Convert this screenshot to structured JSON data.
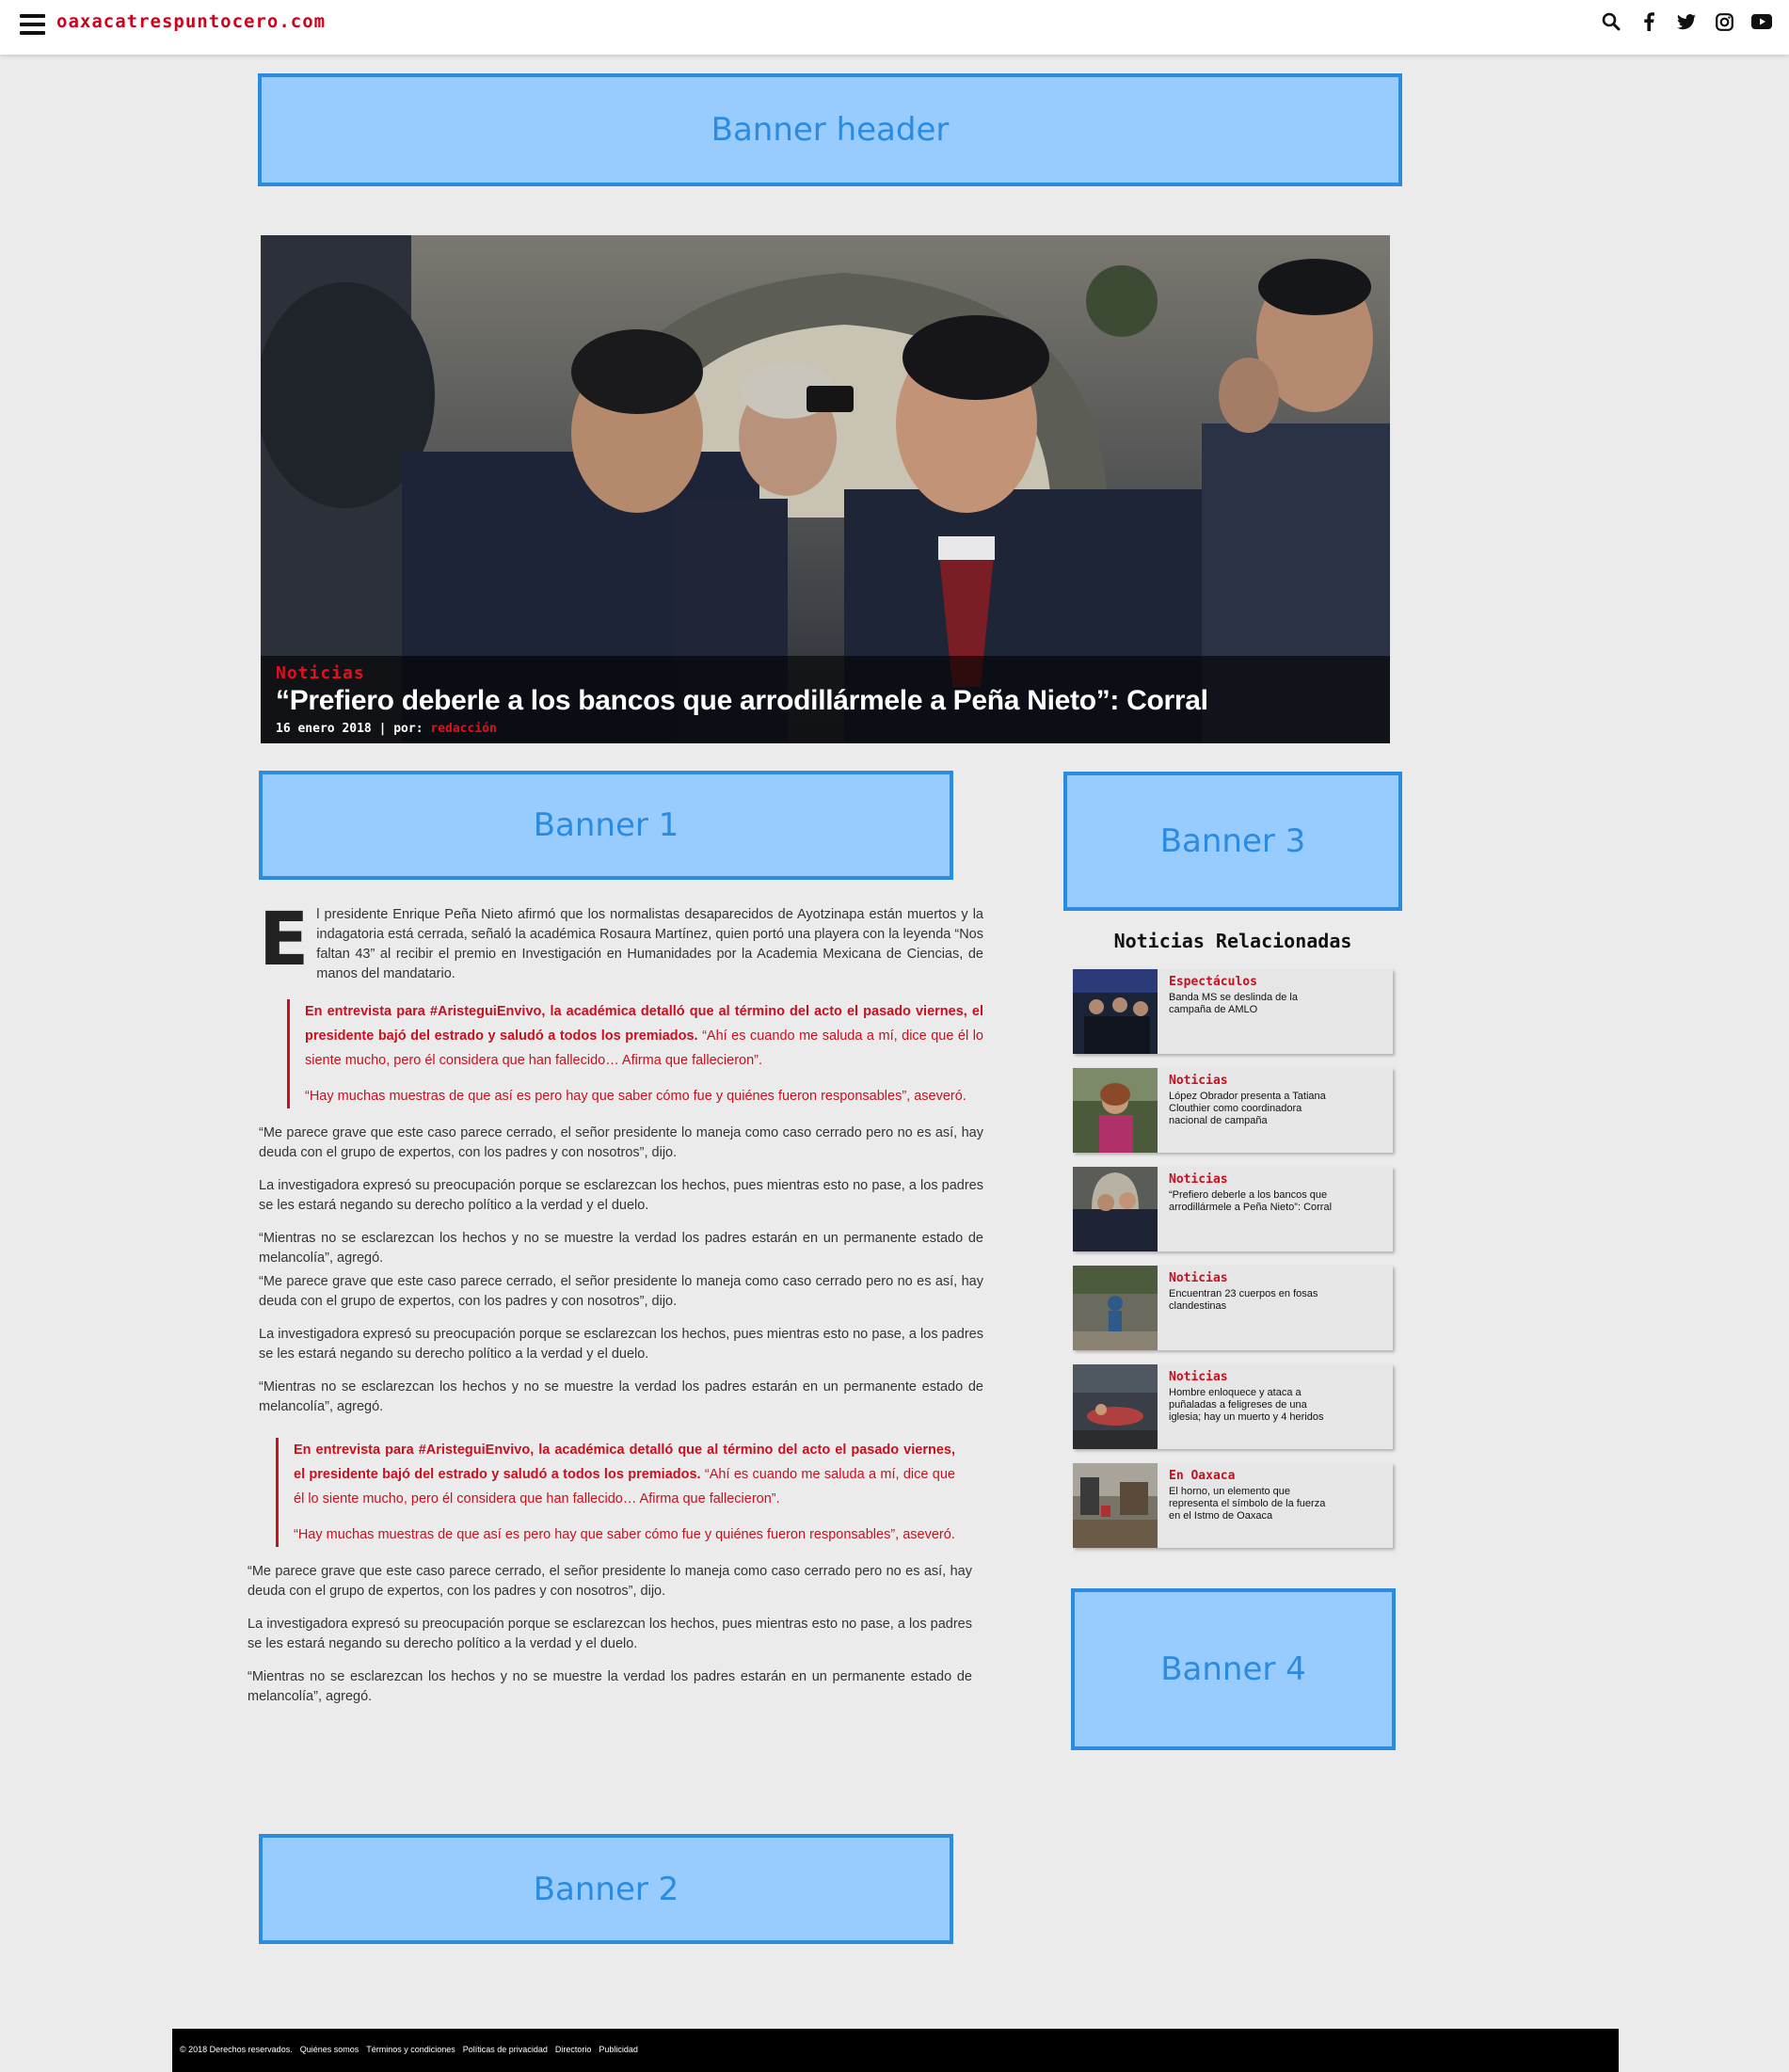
{
  "site": {
    "logo": "oaxacatrespuntocero.com",
    "icons": [
      "search-icon",
      "facebook-icon",
      "twitter-icon",
      "instagram-icon",
      "youtube-icon"
    ]
  },
  "banners": {
    "header": "Banner header",
    "b1": "Banner 1",
    "b2": "Banner 2",
    "b3": "Banner 3",
    "b4": "Banner 4"
  },
  "hero": {
    "category": "Noticias",
    "title": "“Prefiero deberle a los bancos que arrodillármele a Peña Nieto”: Corral",
    "date": "16 enero 2018",
    "separator": "|",
    "by": "por:",
    "author": "redacción"
  },
  "article": {
    "dropcap": "E",
    "intro": "l presidente Enrique Peña Nieto afirmó que los normalistas desaparecidos de Ayotzinapa están muertos y la indagatoria está cerrada, señaló la académica Rosaura Martínez, quien portó una playera con la leyenda “Nos faltan 43” al recibir el premio en Investigación en Humanidades por la Academia Mexicana de Ciencias, de manos del mandatario.",
    "quote_bold": "En entrevista para #AristeguiEnvivo, la académica detalló que al término del acto el pasado viernes, el presidente bajó del estrado y saludó a todos los premiados.",
    "quote_rest": " “Ahí es cuando me saluda a mí, dice que él lo siente mucho, pero él considera que han fallecido… Afirma que fallecieron”.",
    "quote_2": "“Hay muchas muestras de que así es pero hay que saber cómo fue y quiénes fueron responsables”, aseveró.",
    "p1": "“Me parece grave que este caso parece cerrado, el señor presidente lo maneja como caso cerrado pero no es así, hay deuda con el grupo de expertos, con los padres y con nosotros”, dijo.",
    "p2": "La investigadora expresó su preocupación porque se esclarezcan los hechos, pues mientras esto no pase, a los padres se les estará negando su derecho político a la verdad y el duelo.",
    "p3": "“Mientras no se esclarezcan los hechos y no se muestre la verdad los padres estarán en un permanente estado de melancolía”, agregó."
  },
  "related": {
    "title": "Noticias Relacionadas",
    "items": [
      {
        "category": "Espectáculos",
        "title": "Banda MS se deslinda de la campaña de AMLO"
      },
      {
        "category": "Noticias",
        "title": "López Obrador presenta a Tatiana Clouthier como coordinadora nacional de campaña"
      },
      {
        "category": "Noticias",
        "title": "“Prefiero deberle a los bancos que arrodillármele a Peña Nieto”: Corral"
      },
      {
        "category": "Noticias",
        "title": "Encuentran 23 cuerpos en fosas clandestinas"
      },
      {
        "category": "Noticias",
        "title": "Hombre enloquece y ataca a puñaladas a feligreses de una iglesia; hay un muerto y 4 heridos"
      },
      {
        "category": "En Oaxaca",
        "title": "El horno, un elemento que representa el símbolo de la fuerza en el Istmo de Oaxaca"
      }
    ]
  },
  "footer": {
    "copyright": "© 2018 Derechos reservados.",
    "links": [
      "Quiénes somos",
      "Términos y condiciones",
      "Políticas de privacidad",
      "Directorio",
      "Publicidad"
    ]
  }
}
